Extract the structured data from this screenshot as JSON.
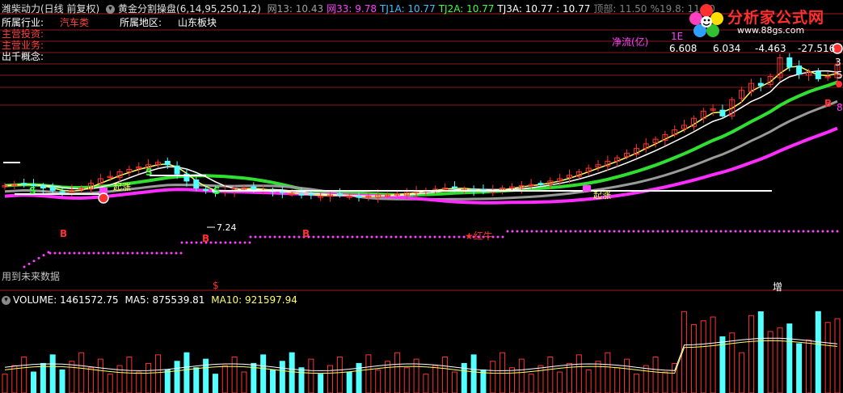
{
  "header": {
    "stock": "潍柴动力(日线 前复权)",
    "indicator": "黄金分割操盘(6,14,95,250,1,2)",
    "items": [
      {
        "label": "网13: 10.43",
        "color": "#a0a0a0"
      },
      {
        "label": "网33: 9.78",
        "color": "#ff40ff"
      },
      {
        "label": "TJ1A: 10.77",
        "color": "#40c0ff"
      },
      {
        "label": "TJ2A: 10.77",
        "color": "#40ff40"
      },
      {
        "label": "TJ3A: 10.77",
        "color": "#ffffff"
      },
      {
        "label": ": 10.77",
        "color": "#ffffff"
      },
      {
        "label": "顶部: 11.50",
        "color": "#808080"
      },
      {
        "label": "%19.8: 11.10",
        "color": "#808080"
      }
    ]
  },
  "info": {
    "industry_label": "所属行业:",
    "industry_value": "汽车类",
    "region_label": "所属地区:",
    "region_value": "山东板块",
    "invest_label": "主营投资:",
    "business_label": "主营业务:",
    "concept_label": "出千概念:"
  },
  "fund": {
    "label": "净流(亿)",
    "unit": "1E",
    "values": [
      "6.608",
      "6.034",
      "-4.463",
      "-27.516"
    ]
  },
  "annotations": {
    "low_price": "7.24",
    "star_label": "★红牛",
    "future": "用到未来数据",
    "dollar": "$",
    "zeng": "增",
    "s_mark": "S",
    "b_mark": "B",
    "start_up": "起涨"
  },
  "right_values": [
    "3",
    "5",
    "8"
  ],
  "volume": {
    "label": "VOLUME: 1461572.75",
    "ma5": "MA5: 875539.81",
    "ma10": "MA10: 921597.94"
  },
  "logo": {
    "title": "分析家公式网",
    "url": "www.88gs.com"
  },
  "colors": {
    "up": "#ff3232",
    "down": "#54ffff",
    "ma_yellow": "#ffff66",
    "ma_white": "#ffffff",
    "ma_green": "#30e030",
    "ma_gray": "#9a9a9a",
    "ma_magenta": "#ff2cff",
    "grid": "#8a1a1a"
  },
  "chart_data": {
    "type": "candlestick",
    "close_approx": [
      9.1,
      9.15,
      9.2,
      9.1,
      9.0,
      8.9,
      8.8,
      8.9,
      9.0,
      9.2,
      9.4,
      9.5,
      9.7,
      9.8,
      9.9,
      10.0,
      10.1,
      10.0,
      9.6,
      9.3,
      9.0,
      8.9,
      8.8,
      8.9,
      9.0,
      9.0,
      8.95,
      8.9,
      8.85,
      8.8,
      8.75,
      8.7,
      8.7,
      8.65,
      8.7,
      8.7,
      8.65,
      8.6,
      8.65,
      8.7,
      8.7,
      8.75,
      8.8,
      8.85,
      8.9,
      8.95,
      9.0,
      9.0,
      8.95,
      8.9,
      8.85,
      8.9,
      9.0,
      9.05,
      9.1,
      9.15,
      9.2,
      9.3,
      9.4,
      9.55,
      9.7,
      9.85,
      10.0,
      10.15,
      10.3,
      10.5,
      10.7,
      10.9,
      11.1,
      11.3,
      11.5,
      11.7,
      12.0,
      12.3,
      12.4,
      12.1,
      12.8,
      13.2,
      13.5,
      13.4,
      13.8,
      14.6,
      14.2,
      13.9,
      14.0,
      13.7,
      13.8,
      14.3
    ],
    "labels_on_chart": [
      "7.24",
      "★红牛",
      "S",
      "B",
      "起涨"
    ],
    "volume": {
      "last": 1461572.75,
      "ma5": 875539.81,
      "ma10": 921597.94
    }
  }
}
